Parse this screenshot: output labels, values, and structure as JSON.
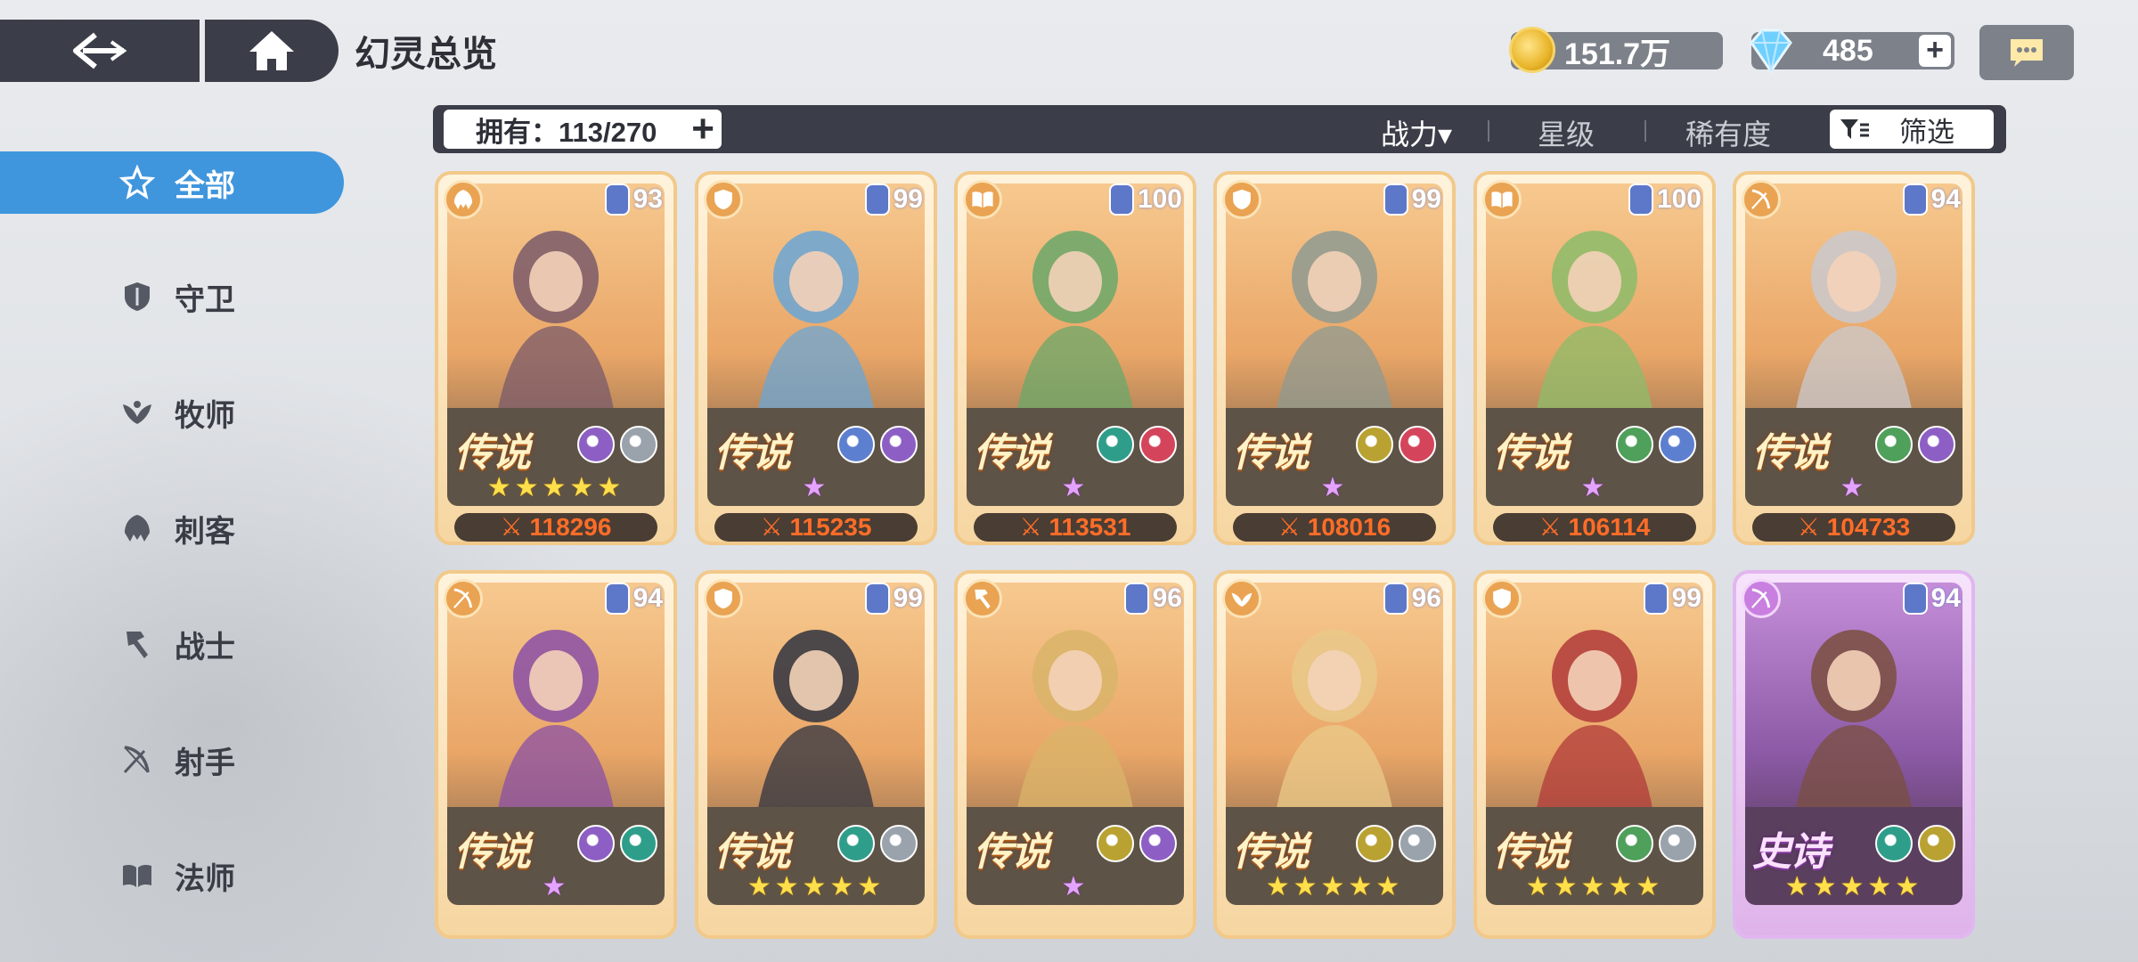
{
  "header": {
    "title": "幻灵总览"
  },
  "currency": {
    "gold": "151.7万",
    "gems": "485"
  },
  "toolbar": {
    "owned": "拥有：113/270",
    "sort_power": "战力",
    "sort_power_arrow": "▾",
    "sort_stars": "星级",
    "sort_rarity": "稀有度",
    "filter": "筛选"
  },
  "sidebar": {
    "items": [
      {
        "label": "全部",
        "icon": "all-icon",
        "active": true
      },
      {
        "label": "守卫",
        "icon": "shield-icon"
      },
      {
        "label": "牧师",
        "icon": "priest-icon"
      },
      {
        "label": "刺客",
        "icon": "assassin-icon"
      },
      {
        "label": "战士",
        "icon": "warrior-icon"
      },
      {
        "label": "射手",
        "icon": "archer-icon"
      },
      {
        "label": "法师",
        "icon": "book-icon"
      }
    ]
  },
  "cards": [
    {
      "level": "93",
      "rarity": "传说",
      "stars": "★★★★★",
      "star_color": "gold",
      "power": "118296",
      "class_icon": "assassin-icon",
      "elements": [
        "#8d5fc4",
        "#9aa2ab"
      ],
      "epic": false
    },
    {
      "level": "99",
      "rarity": "传说",
      "stars": "★",
      "star_color": "pink",
      "power": "115235",
      "class_icon": "shield-icon",
      "elements": [
        "#5d7fd0",
        "#8d5fc4"
      ],
      "epic": false
    },
    {
      "level": "100",
      "rarity": "传说",
      "stars": "★",
      "star_color": "pink",
      "power": "113531",
      "class_icon": "book-icon",
      "elements": [
        "#2e9e8a",
        "#d4455c"
      ],
      "epic": false
    },
    {
      "level": "99",
      "rarity": "传说",
      "stars": "★",
      "star_color": "pink",
      "power": "108016",
      "class_icon": "shield-icon",
      "elements": [
        "#b9a232",
        "#d4455c"
      ],
      "epic": false
    },
    {
      "level": "100",
      "rarity": "传说",
      "stars": "★",
      "star_color": "pink",
      "power": "106114",
      "class_icon": "book-icon",
      "elements": [
        "#4fa05a",
        "#5d7fd0"
      ],
      "epic": false
    },
    {
      "level": "94",
      "rarity": "传说",
      "stars": "★",
      "star_color": "pink",
      "power": "104733",
      "class_icon": "archer-icon",
      "elements": [
        "#4fa05a",
        "#8d5fc4"
      ],
      "epic": false
    },
    {
      "level": "94",
      "rarity": "传说",
      "stars": "★",
      "star_color": "pink",
      "class_icon": "archer-icon",
      "elements": [
        "#8d5fc4",
        "#2e9e8a"
      ],
      "epic": false
    },
    {
      "level": "99",
      "rarity": "传说",
      "stars": "★★★★★",
      "star_color": "gold",
      "class_icon": "shield-icon",
      "elements": [
        "#2e9e8a",
        "#9aa2ab"
      ],
      "epic": false
    },
    {
      "level": "96",
      "rarity": "传说",
      "stars": "★",
      "star_color": "pink",
      "class_icon": "warrior-icon",
      "elements": [
        "#b9a232",
        "#8d5fc4"
      ],
      "epic": false
    },
    {
      "level": "96",
      "rarity": "传说",
      "stars": "★★★★★",
      "star_color": "gold",
      "class_icon": "priest-icon",
      "elements": [
        "#b9a232",
        "#9aa2ab"
      ],
      "epic": false
    },
    {
      "level": "99",
      "rarity": "传说",
      "stars": "★★★★★",
      "star_color": "gold",
      "class_icon": "shield-icon",
      "elements": [
        "#4fa05a",
        "#9aa2ab"
      ],
      "epic": false
    },
    {
      "level": "94",
      "rarity": "史诗",
      "stars": "★★★★★",
      "star_color": "gold",
      "class_icon": "archer-icon",
      "elements": [
        "#2e9e8a",
        "#b9a232"
      ],
      "epic": true
    }
  ]
}
